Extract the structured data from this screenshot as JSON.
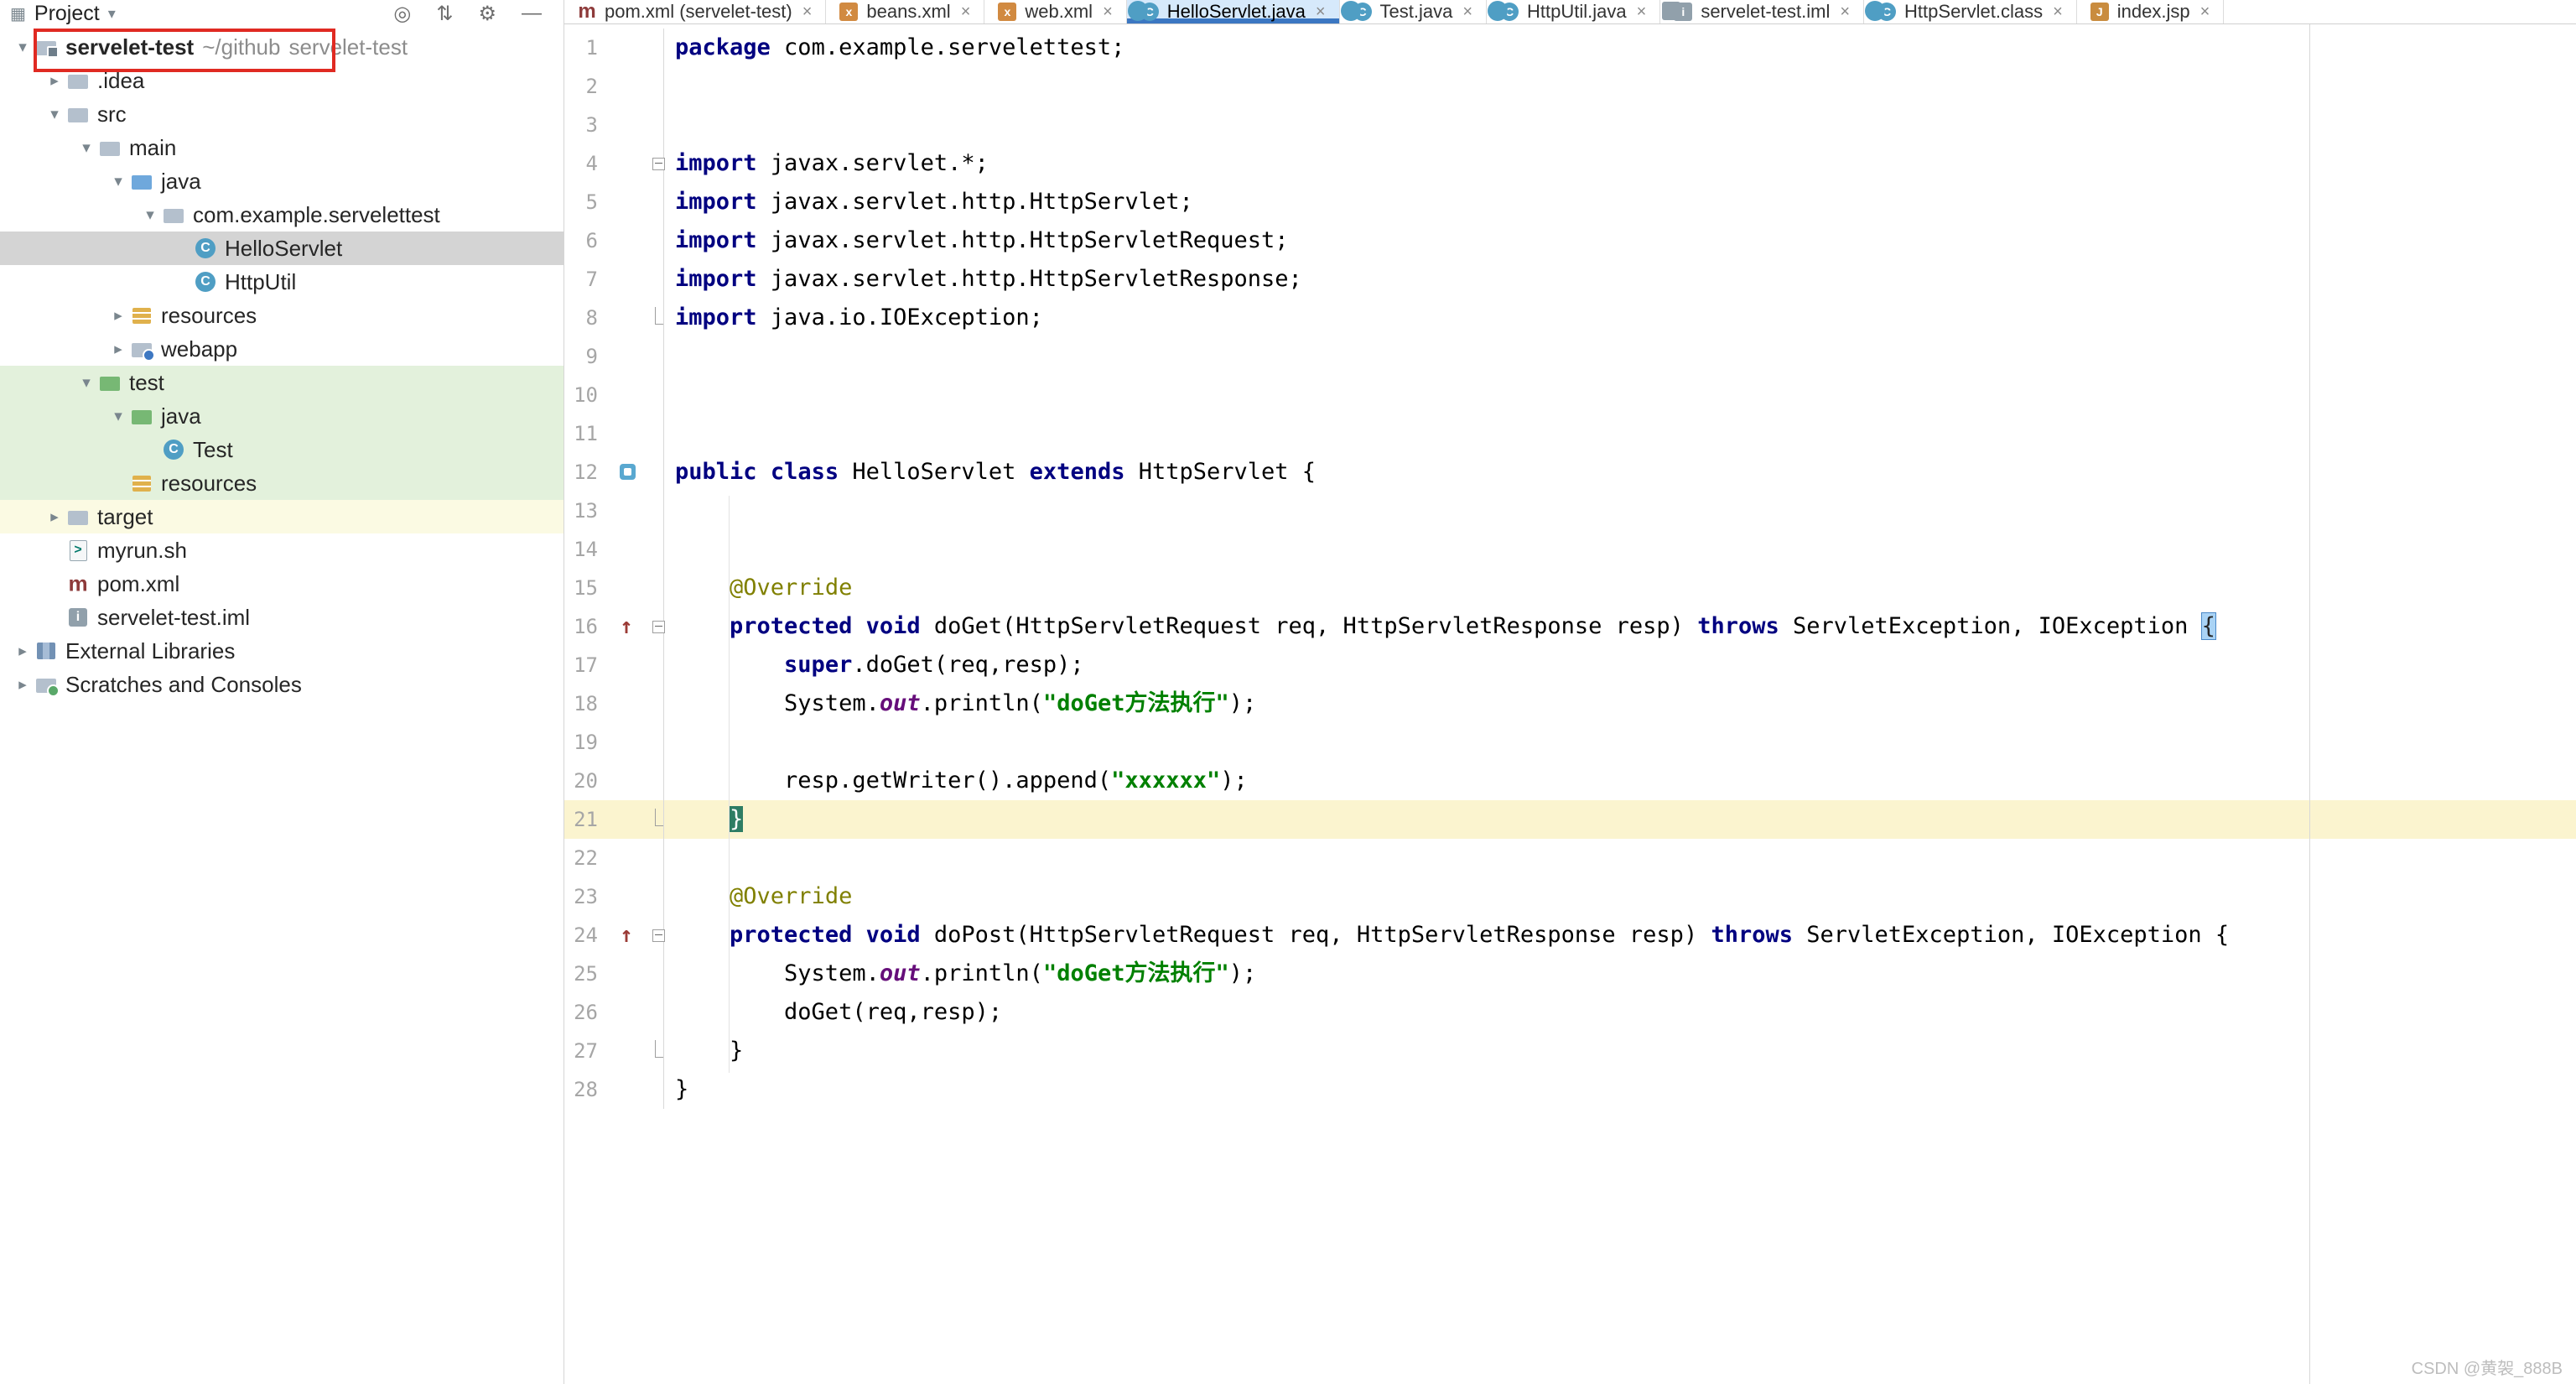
{
  "project_panel": {
    "header": {
      "title": "Project",
      "panel_icon_glyph": "▦",
      "icons": [
        {
          "name": "locate-file",
          "glyph": "◎"
        },
        {
          "name": "expand-collapse",
          "glyph": "⇅"
        },
        {
          "name": "settings-gear",
          "glyph": "⚙"
        },
        {
          "name": "hide-panel",
          "glyph": "—"
        }
      ]
    },
    "tree": [
      {
        "label": "servelet-test",
        "hint": "~/github",
        "hint2": "servelet-test",
        "level": 0,
        "chevron": "expanded",
        "icon": "folder-project",
        "bold": true,
        "bg": "",
        "annotated": true
      },
      {
        "label": ".idea",
        "level": 1,
        "chevron": "collapsed",
        "icon": "folder",
        "bg": ""
      },
      {
        "label": "src",
        "level": 1,
        "chevron": "expanded",
        "icon": "folder",
        "bg": ""
      },
      {
        "label": "main",
        "level": 2,
        "chevron": "expanded",
        "icon": "folder",
        "bg": ""
      },
      {
        "label": "java",
        "level": 3,
        "chevron": "expanded",
        "icon": "folder-java",
        "bg": ""
      },
      {
        "label": "com.example.servelettest",
        "level": 4,
        "chevron": "expanded",
        "icon": "package",
        "bg": ""
      },
      {
        "label": "HelloServlet",
        "level": 5,
        "chevron": "none",
        "icon": "class",
        "bg": "selected"
      },
      {
        "label": "HttpUtil",
        "level": 5,
        "chevron": "none",
        "icon": "class",
        "bg": ""
      },
      {
        "label": "resources",
        "level": 3,
        "chevron": "collapsed",
        "icon": "resources",
        "bg": ""
      },
      {
        "label": "webapp",
        "level": 3,
        "chevron": "collapsed",
        "icon": "folder-web",
        "bg": ""
      },
      {
        "label": "test",
        "level": 2,
        "chevron": "expanded",
        "icon": "folder-test",
        "bg": "green"
      },
      {
        "label": "java",
        "level": 3,
        "chevron": "expanded",
        "icon": "folder-testjava",
        "bg": "green"
      },
      {
        "label": "Test",
        "level": 4,
        "chevron": "none",
        "icon": "class",
        "bg": "green"
      },
      {
        "label": "resources",
        "level": 3,
        "chevron": "none",
        "icon": "resources",
        "bg": "green"
      },
      {
        "label": "target",
        "level": 1,
        "chevron": "collapsed",
        "icon": "folder",
        "bg": "yellow"
      },
      {
        "label": "myrun.sh",
        "level": 1,
        "chevron": "none",
        "icon": "script",
        "bg": ""
      },
      {
        "label": "pom.xml",
        "level": 1,
        "chevron": "none",
        "icon": "maven",
        "bg": ""
      },
      {
        "label": "servelet-test.iml",
        "level": 1,
        "chevron": "none",
        "icon": "iml",
        "bg": ""
      },
      {
        "label": "External Libraries",
        "level": 0,
        "chevron": "collapsed",
        "icon": "libraries",
        "bg": ""
      },
      {
        "label": "Scratches and Consoles",
        "level": 0,
        "chevron": "collapsed",
        "icon": "scratches",
        "bg": ""
      }
    ]
  },
  "tabs": [
    {
      "label": "pom.xml (servelet-test)",
      "icon": "maven",
      "active": false
    },
    {
      "label": "beans.xml",
      "icon": "xml",
      "active": false
    },
    {
      "label": "web.xml",
      "icon": "xml",
      "active": false
    },
    {
      "label": "HelloServlet.java",
      "icon": "class",
      "active": true
    },
    {
      "label": "Test.java",
      "icon": "class",
      "active": false
    },
    {
      "label": "HttpUtil.java",
      "icon": "class",
      "active": false
    },
    {
      "label": "servelet-test.iml",
      "icon": "iml",
      "active": false
    },
    {
      "label": "HttpServlet.class",
      "icon": "class",
      "active": false
    },
    {
      "label": "index.jsp",
      "icon": "jsp",
      "active": false
    }
  ],
  "editor": {
    "lines": [
      {
        "num": 1,
        "tokens": [
          {
            "c": "kw",
            "t": "package"
          },
          {
            "c": "p",
            "t": " com.example.servelettest;"
          }
        ]
      },
      {
        "num": 2,
        "tokens": []
      },
      {
        "num": 3,
        "tokens": []
      },
      {
        "num": 4,
        "fold": "start",
        "tokens": [
          {
            "c": "kw",
            "t": "import"
          },
          {
            "c": "p",
            "t": " javax.servlet.*;"
          }
        ]
      },
      {
        "num": 5,
        "tokens": [
          {
            "c": "kw",
            "t": "import"
          },
          {
            "c": "p",
            "t": " javax.servlet.http.HttpServlet;"
          }
        ]
      },
      {
        "num": 6,
        "tokens": [
          {
            "c": "kw",
            "t": "import"
          },
          {
            "c": "p",
            "t": " javax.servlet.http.HttpServletRequest;"
          }
        ]
      },
      {
        "num": 7,
        "tokens": [
          {
            "c": "kw",
            "t": "import"
          },
          {
            "c": "p",
            "t": " javax.servlet.http.HttpServletResponse;"
          }
        ]
      },
      {
        "num": 8,
        "fold": "end",
        "tokens": [
          {
            "c": "kw",
            "t": "import"
          },
          {
            "c": "p",
            "t": " java.io.IOException;"
          }
        ]
      },
      {
        "num": 9,
        "tokens": []
      },
      {
        "num": 10,
        "tokens": []
      },
      {
        "num": 11,
        "tokens": []
      },
      {
        "num": 12,
        "gutter": "related",
        "tokens": [
          {
            "c": "kw",
            "t": "public"
          },
          {
            "c": "p",
            "t": " "
          },
          {
            "c": "kw",
            "t": "class"
          },
          {
            "c": "p",
            "t": " HelloServlet "
          },
          {
            "c": "kw",
            "t": "extends"
          },
          {
            "c": "p",
            "t": " HttpServlet {"
          }
        ]
      },
      {
        "num": 13,
        "tokens": []
      },
      {
        "num": 14,
        "tokens": []
      },
      {
        "num": 15,
        "tokens": [
          {
            "c": "p",
            "t": "    "
          },
          {
            "c": "ann",
            "t": "@Override"
          }
        ]
      },
      {
        "num": 16,
        "gutter": "override",
        "fold": "start",
        "tokens": [
          {
            "c": "p",
            "t": "    "
          },
          {
            "c": "kw",
            "t": "protected"
          },
          {
            "c": "p",
            "t": " "
          },
          {
            "c": "kw",
            "t": "void"
          },
          {
            "c": "p",
            "t": " doGet(HttpServletRequest req, HttpServletResponse resp) "
          },
          {
            "c": "kw",
            "t": "throws"
          },
          {
            "c": "p",
            "t": " ServletException, IOException "
          },
          {
            "c": "brace_open",
            "t": "{"
          }
        ]
      },
      {
        "num": 17,
        "tokens": [
          {
            "c": "p",
            "t": "        "
          },
          {
            "c": "kw",
            "t": "super"
          },
          {
            "c": "p",
            "t": ".doGet(req,resp);"
          }
        ]
      },
      {
        "num": 18,
        "tokens": [
          {
            "c": "p",
            "t": "        System."
          },
          {
            "c": "field",
            "t": "out"
          },
          {
            "c": "p",
            "t": ".println("
          },
          {
            "c": "str",
            "t": "\"doGet方法执行\""
          },
          {
            "c": "p",
            "t": ");"
          }
        ]
      },
      {
        "num": 19,
        "tokens": []
      },
      {
        "num": 20,
        "tokens": [
          {
            "c": "p",
            "t": "        resp.getWriter().append("
          },
          {
            "c": "str",
            "t": "\"xxxxxx\""
          },
          {
            "c": "p",
            "t": ");"
          }
        ]
      },
      {
        "num": 21,
        "caret": true,
        "fold": "end",
        "tokens": [
          {
            "c": "p",
            "t": "    "
          },
          {
            "c": "brace_caret",
            "t": "}"
          }
        ]
      },
      {
        "num": 22,
        "tokens": []
      },
      {
        "num": 23,
        "tokens": [
          {
            "c": "p",
            "t": "    "
          },
          {
            "c": "ann",
            "t": "@Override"
          }
        ]
      },
      {
        "num": 24,
        "gutter": "override",
        "fold": "start",
        "tokens": [
          {
            "c": "p",
            "t": "    "
          },
          {
            "c": "kw",
            "t": "protected"
          },
          {
            "c": "p",
            "t": " "
          },
          {
            "c": "kw",
            "t": "void"
          },
          {
            "c": "p",
            "t": " doPost(HttpServletRequest req, HttpServletResponse resp) "
          },
          {
            "c": "kw",
            "t": "throws"
          },
          {
            "c": "p",
            "t": " ServletException, IOException {"
          }
        ]
      },
      {
        "num": 25,
        "tokens": [
          {
            "c": "p",
            "t": "        System."
          },
          {
            "c": "field",
            "t": "out"
          },
          {
            "c": "p",
            "t": ".println("
          },
          {
            "c": "str",
            "t": "\"doGet方法执行\""
          },
          {
            "c": "p",
            "t": ");"
          }
        ]
      },
      {
        "num": 26,
        "tokens": [
          {
            "c": "p",
            "t": "        doGet(req,resp);"
          }
        ]
      },
      {
        "num": 27,
        "fold": "end",
        "tokens": [
          {
            "c": "p",
            "t": "    }"
          }
        ]
      },
      {
        "num": 28,
        "tokens": [
          {
            "c": "p",
            "t": "}"
          }
        ]
      }
    ]
  },
  "watermark": "CSDN @黄袈_888B",
  "ui": {
    "close_glyph": "×",
    "chevron_expanded": "▾",
    "chevron_collapsed": "▸",
    "caret_down": "▾",
    "override_glyph": "↑",
    "icon_letters": {
      "class": "C",
      "maven": "m",
      "iml": "i",
      "script": ">",
      "jsp": "J",
      "xml": "x"
    }
  },
  "colors": {
    "accent_blue": "#3C77C2",
    "active_tab_bg": "#D6E9FB",
    "selection_gray": "#D4D4D4",
    "test_green_bg": "#E3F1DC",
    "excluded_yellow_bg": "#FBFAE3",
    "caret_line_yellow": "#FBF4CF",
    "keyword": "#000080",
    "string": "#008000",
    "annotation": "#808000",
    "static_field": "#660E7A",
    "annotation_box_red": "#E02A22"
  }
}
